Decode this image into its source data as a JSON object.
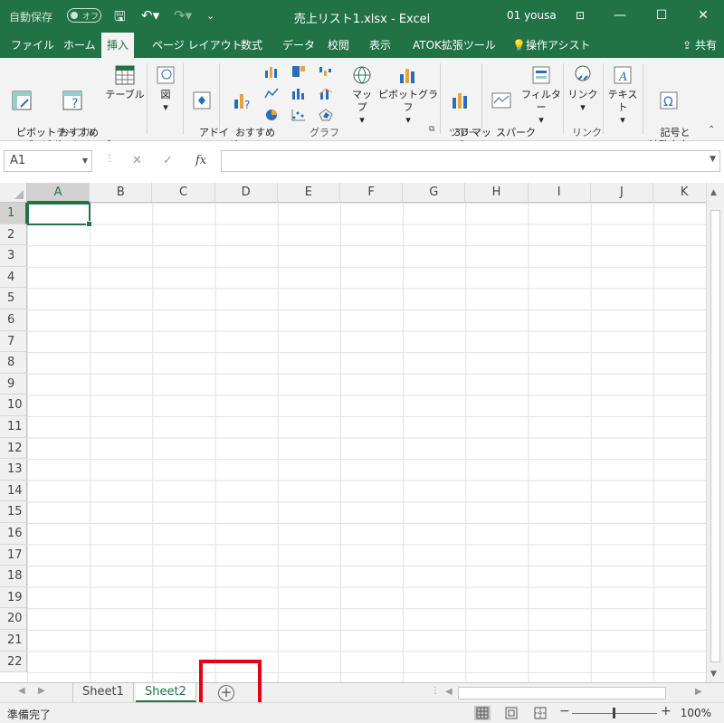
{
  "titlebar": {
    "autosave_label": "自動保存",
    "autosave_state": "オフ",
    "title": "売上リスト1.xlsx  -  Excel",
    "user": "01 yousa"
  },
  "tabs": [
    {
      "label": "ファイル"
    },
    {
      "label": "ホーム"
    },
    {
      "label": "挿入"
    },
    {
      "label": "ページ レイアウト"
    },
    {
      "label": "数式"
    },
    {
      "label": "データ"
    },
    {
      "label": "校閲"
    },
    {
      "label": "表示"
    },
    {
      "label": "ATOK拡張ツール"
    },
    {
      "label": "操作アシスト"
    }
  ],
  "active_tab": "挿入",
  "share_label": "共有",
  "ribbon": {
    "pivot_table": "ピボット\nテーブル",
    "recommended_pivot": "おすすめ\nピボットテーブル",
    "table": "テーブル",
    "group_table": "テーブル",
    "figure": "図",
    "addin": "アドイ\nン",
    "recommended_chart": "おすすめ\nグラフ",
    "map": "マップ",
    "pivot_chart": "ピボットグラフ",
    "group_chart": "グラフ",
    "map3d": "3D マッ\nプ",
    "group_tour": "ツアー",
    "sparkline": "スパーク\nライン",
    "filter": "フィルター",
    "link": "リンク",
    "group_link": "リンク",
    "text": "テキスト",
    "symbol": "記号と\n特殊文字"
  },
  "formula_bar": {
    "name_box": "A1",
    "fx_label": "fx",
    "formula": ""
  },
  "columns": [
    "A",
    "B",
    "C",
    "D",
    "E",
    "F",
    "G",
    "H",
    "I",
    "J",
    "K"
  ],
  "rows": [
    "1",
    "2",
    "3",
    "4",
    "5",
    "6",
    "7",
    "8",
    "9",
    "10",
    "11",
    "12",
    "13",
    "14",
    "15",
    "16",
    "17",
    "18",
    "19",
    "20",
    "21",
    "22"
  ],
  "sheets": [
    {
      "label": "Sheet1"
    },
    {
      "label": "Sheet2"
    }
  ],
  "active_sheet": "Sheet2",
  "status": {
    "ready": "準備完了",
    "zoom": "100%"
  },
  "colors": {
    "accent": "#217346",
    "highlight": "#e60012"
  }
}
